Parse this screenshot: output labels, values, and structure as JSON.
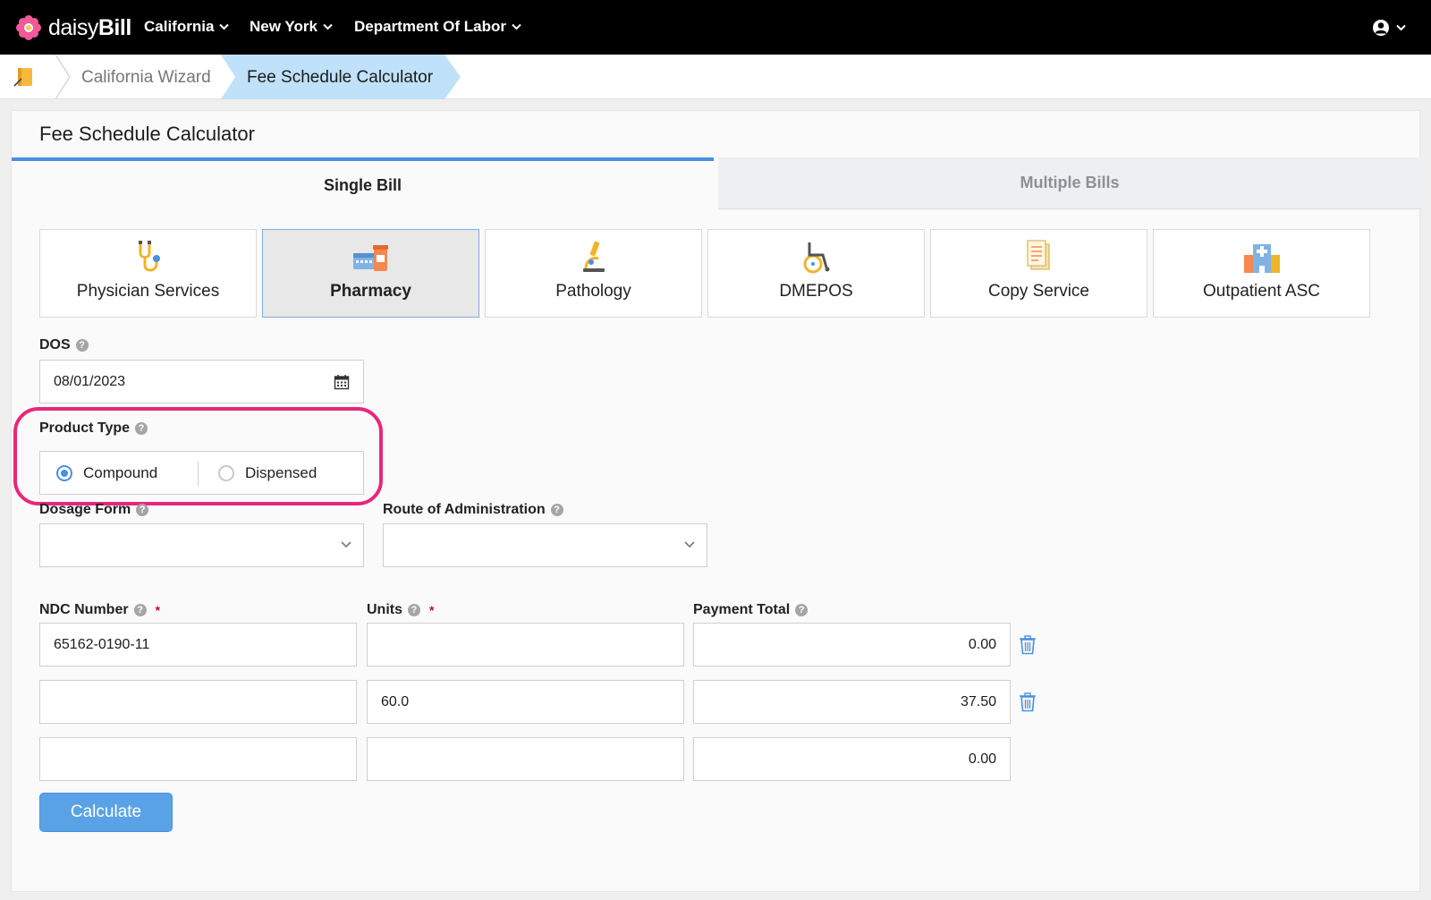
{
  "nav": {
    "logo_prefix": "daisy",
    "logo_bold": "Bill",
    "items": [
      {
        "label": "California"
      },
      {
        "label": "New York"
      },
      {
        "label": "Department Of Labor"
      }
    ],
    "user_icon": "user-circle-icon"
  },
  "breadcrumb": {
    "home_icon": "notebook-icon",
    "items": [
      {
        "label": "California Wizard"
      },
      {
        "label": "Fee Schedule Calculator"
      }
    ],
    "active_color": "#bfe1f9"
  },
  "page": {
    "title": "Fee Schedule Calculator",
    "tabs": [
      {
        "label": "Single Bill",
        "active": true
      },
      {
        "label": "Multiple Bills",
        "active": false
      }
    ],
    "categories": [
      {
        "label": "Physician Services",
        "icon": "stethoscope-icon"
      },
      {
        "label": "Pharmacy",
        "icon": "pharmacy-icon",
        "active": true
      },
      {
        "label": "Pathology",
        "icon": "microscope-icon"
      },
      {
        "label": "DMEPOS",
        "icon": "wheelchair-icon"
      },
      {
        "label": "Copy Service",
        "icon": "document-copy-icon"
      },
      {
        "label": "Outpatient ASC",
        "icon": "hospital-icon"
      }
    ]
  },
  "form": {
    "dos": {
      "label": "DOS",
      "value": "08/01/2023"
    },
    "product_type": {
      "label": "Product Type",
      "options": [
        {
          "label": "Compound",
          "checked": true
        },
        {
          "label": "Dispensed",
          "checked": false
        }
      ]
    },
    "dosage_form": {
      "label": "Dosage Form",
      "value": ""
    },
    "route": {
      "label": "Route of Administration",
      "value": ""
    },
    "columns": {
      "ndc": "NDC Number",
      "units": "Units",
      "payment": "Payment Total",
      "required_mark": "*"
    },
    "rows": [
      {
        "ndc": "65162-0190-11",
        "units": "",
        "payment": "0.00",
        "deletable": true
      },
      {
        "ndc": "",
        "units": "60.0",
        "payment": "37.50",
        "deletable": true
      },
      {
        "ndc": "",
        "units": "",
        "payment": "0.00",
        "deletable": false
      }
    ],
    "calculate_label": "Calculate"
  },
  "colors": {
    "accent": "#4a90e2",
    "highlight": "#e8277a",
    "required": "#d0021b"
  }
}
